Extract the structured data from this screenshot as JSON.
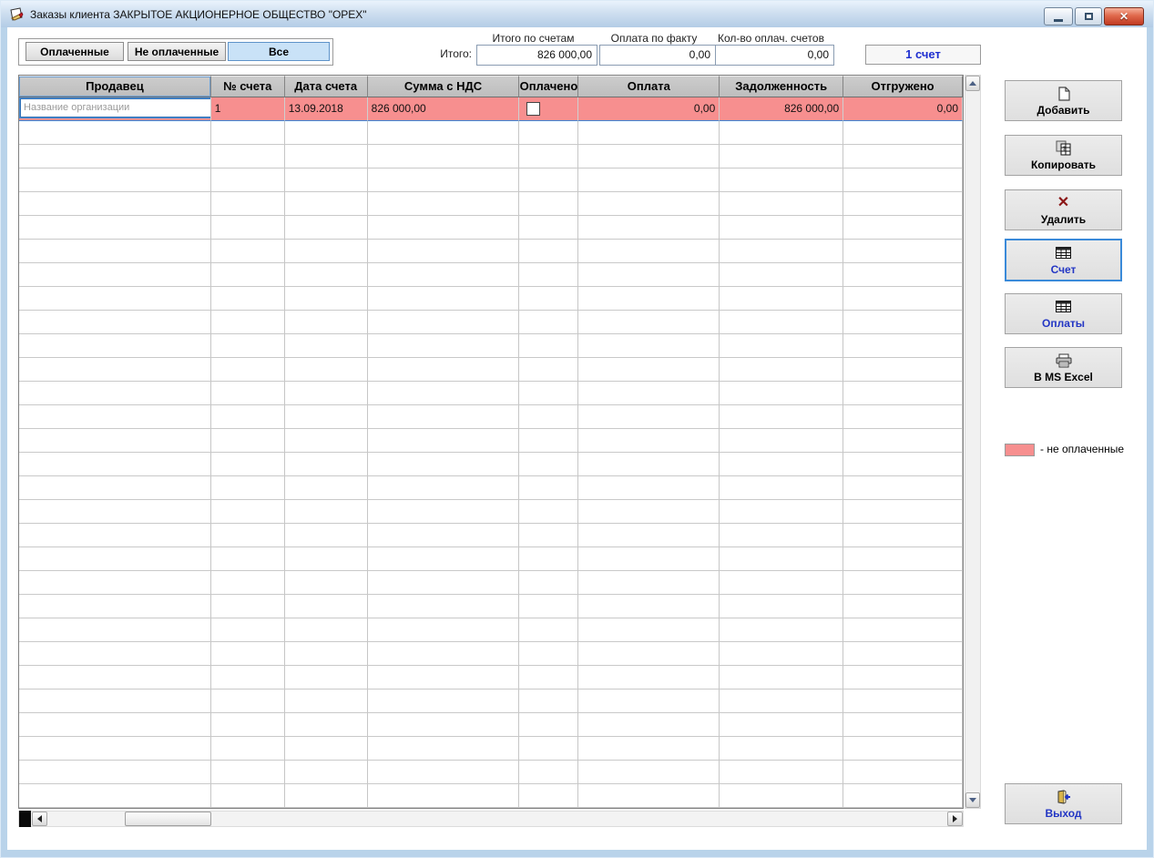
{
  "window": {
    "title": "Заказы клиента ЗАКРЫТОЕ АКЦИОНЕРНОЕ ОБЩЕСТВО \"ОРЕХ\""
  },
  "filters": {
    "paid_label": "Оплаченные",
    "unpaid_label": "Не оплаченные",
    "all_label": "Все"
  },
  "totals": {
    "prefix_label": "Итого:",
    "by_invoices": {
      "label": "Итого по счетам",
      "value": "826 000,00"
    },
    "paid_fact": {
      "label": "Оплата по факту",
      "value": "0,00"
    },
    "paid_count": {
      "label": "Кол-во оплач. счетов",
      "value": "0,00"
    },
    "invoice_count": "1 счет"
  },
  "grid": {
    "columns": [
      "Продавец",
      "№ счета",
      "Дата счета",
      "Сумма с НДС",
      "Оплачено",
      "Оплата",
      "Задолженность",
      "Отгружено"
    ],
    "rows": [
      {
        "seller": "Название организации",
        "invoice_no": "1",
        "invoice_date": "13.09.2018",
        "amount_with_vat": "826 000,00",
        "paid": false,
        "payment": "0,00",
        "debt": "826 000,00",
        "shipped": "0,00"
      }
    ],
    "unpaid_row_color": "#f78f8f"
  },
  "actions": {
    "add": "Добавить",
    "copy": "Копировать",
    "delete": "Удалить",
    "invoice": "Счет",
    "payments": "Оплаты",
    "excel": "В MS Excel",
    "exit": "Выход"
  },
  "legend": {
    "swatch_color": "#f78f8f",
    "text": "- не оплаченные"
  }
}
